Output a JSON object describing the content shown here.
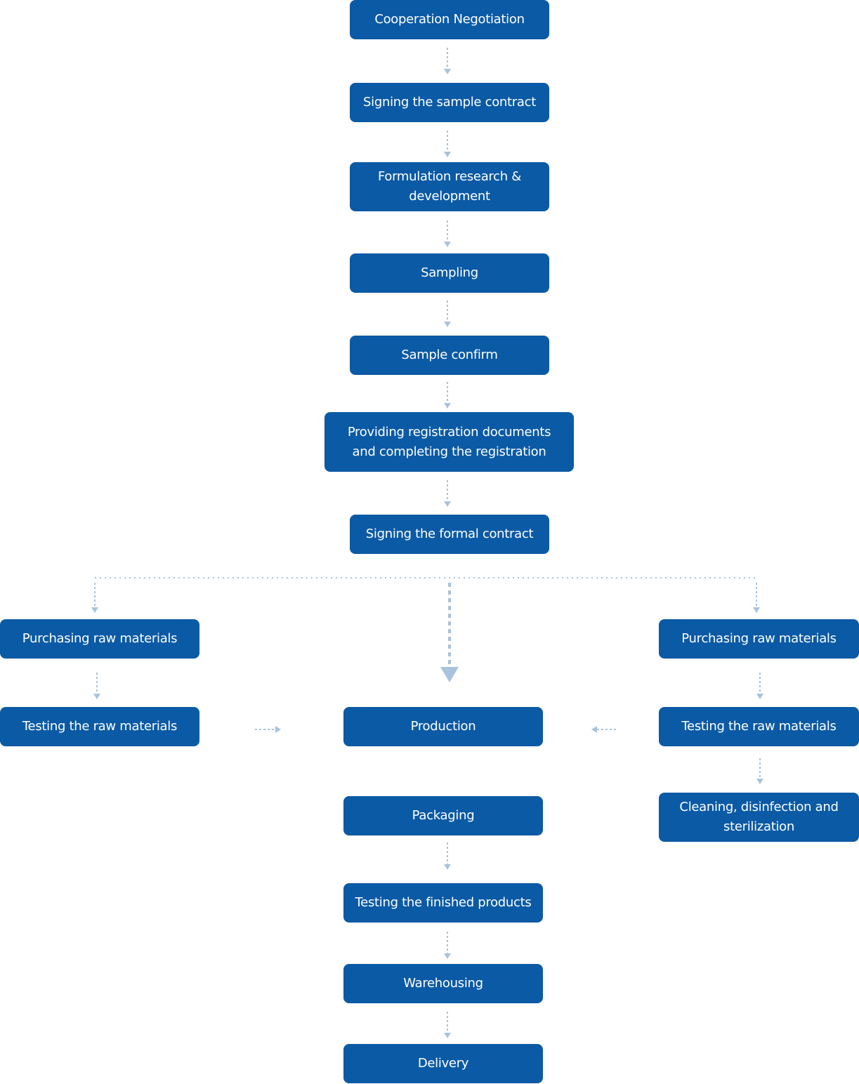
{
  "colors": {
    "box": "#0b5aa5",
    "arrow": "#a9c3dc",
    "text": "#ffffff"
  },
  "steps": {
    "cooperation": "Cooperation Negotiation",
    "sample_contract": "Signing the sample contract",
    "formulation": "Formulation research & development",
    "sampling": "Sampling",
    "sample_confirm": "Sample confirm",
    "registration": "Providing registration documents and completing the registration",
    "formal_contract": "Signing the formal contract",
    "left_purchasing": "Purchasing raw materials",
    "left_testing": "Testing the raw materials",
    "production": "Production",
    "right_purchasing": "Purchasing raw materials",
    "right_testing": "Testing the raw materials",
    "cleaning": "Cleaning, disinfection and sterilization",
    "packaging": "Packaging",
    "testing_finished": "Testing the finished products",
    "warehousing": "Warehousing",
    "delivery": "Delivery"
  }
}
